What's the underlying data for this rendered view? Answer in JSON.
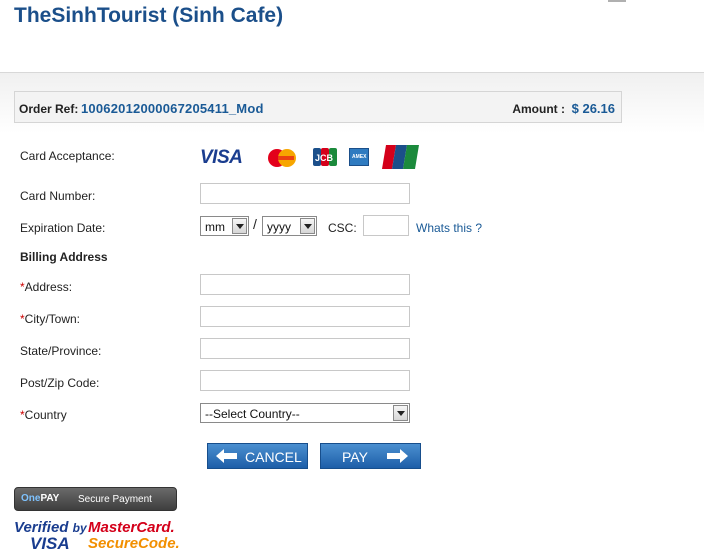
{
  "header": {
    "title": "TheSinhTourist (Sinh Cafe)"
  },
  "order": {
    "ref_label": "Order Ref:",
    "ref_value": "10062012000067205411_Mod",
    "amount_label": "Amount :",
    "amount_value": "$ 26.16"
  },
  "form": {
    "card_acceptance_label": "Card Acceptance:",
    "card_number_label": "Card Number:",
    "expiration_label": "Expiration Date:",
    "month_value": "mm",
    "year_value": "yyyy",
    "separator": "/",
    "csc_label": "CSC:",
    "whats_this": "Whats this ?",
    "billing_heading": "Billing Address",
    "required_mark": "*",
    "address_label": "Address:",
    "city_label": "City/Town:",
    "state_label": "State/Province:",
    "zip_label": "Post/Zip Code:",
    "country_label": "Country",
    "country_value": "--Select Country--"
  },
  "card_logos": [
    "visa-logo",
    "mastercard-logo",
    "jcb-logo",
    "amex-logo",
    "unionpay-logo"
  ],
  "logo_text": {
    "visa": "VISA",
    "amex": "AMEX"
  },
  "buttons": {
    "cancel": "CANCEL",
    "pay": "PAY"
  },
  "footer": {
    "onepay_one": "One",
    "onepay_pay": "PAY",
    "secure_payment": "Secure Payment",
    "vbv_line1": "Verified",
    "vbv_by": "by",
    "vbv_line2": "VISA",
    "mc_line1": "MasterCard.",
    "mc_line2": "SecureCode."
  },
  "colors": {
    "brand": "#1b4f8a",
    "link": "#1a5a96",
    "button": "#1d5ea8",
    "required": "#cc0000"
  }
}
